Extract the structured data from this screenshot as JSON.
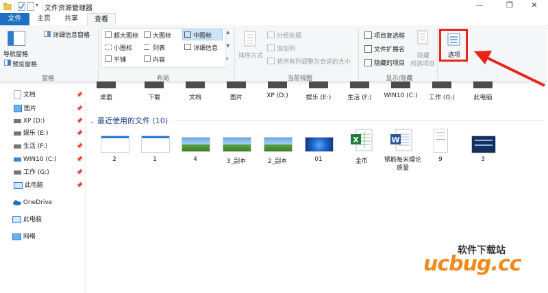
{
  "window": {
    "title": "文件资源管理器",
    "controls": {
      "minimize": "—",
      "maximize": "❐",
      "close": "✕"
    }
  },
  "tabs": [
    {
      "label": "文件"
    },
    {
      "label": "主页"
    },
    {
      "label": "共享"
    },
    {
      "label": "查看"
    }
  ],
  "ribbon": {
    "panes": {
      "group_label": "窗格",
      "nav_pane": "导航窗格",
      "preview_pane": "预览窗格",
      "details_pane": "详细信息窗格"
    },
    "layout": {
      "group_label": "布局",
      "items": [
        "超大图标",
        "大图标",
        "中图标",
        "小图标",
        "列表",
        "详细信息",
        "平铺",
        "内容"
      ]
    },
    "current_view": {
      "group_label": "当前视图",
      "sort": "排序方式",
      "group_by": "分组依据",
      "add_column": "添加列",
      "fit_columns": "将所有列调整为合适的大小"
    },
    "show_hide": {
      "group_label": "显示/隐藏",
      "item_checkboxes": "项目复选框",
      "file_extensions": "文件扩展名",
      "hidden_items": "隐藏的项目",
      "hide": "隐藏",
      "selected_items": "所选项目"
    },
    "options": {
      "label": "选项"
    }
  },
  "nav": {
    "quick": [
      {
        "label": "文档"
      },
      {
        "label": "图片"
      },
      {
        "label": "XP (D:)"
      },
      {
        "label": "娱乐 (E:)"
      },
      {
        "label": "生活 (F:)"
      },
      {
        "label": "WIN10 (C:)"
      },
      {
        "label": "工作 (G:)"
      },
      {
        "label": "此电脑"
      }
    ],
    "onedrive": "OneDrive",
    "thispc": "此电脑",
    "network": "网络"
  },
  "folders": [
    "桌面",
    "下载",
    "文档",
    "图片",
    "XP (D:)",
    "娱乐 (E:)",
    "生活 (F:)",
    "WIN10 (C:)",
    "工作 (G:)",
    "此电脑"
  ],
  "recent": {
    "header": "最近使用的文件 (10)",
    "files": [
      {
        "label": "2"
      },
      {
        "label": "1"
      },
      {
        "label": "4"
      },
      {
        "label": "3_副本"
      },
      {
        "label": "2_副本"
      },
      {
        "label": "01"
      },
      {
        "label": "金币"
      },
      {
        "label": "钢筋每米理论质量"
      },
      {
        "label": "9"
      },
      {
        "label": "3"
      }
    ]
  },
  "watermark": {
    "site_cn": "软件下载站",
    "site_en": "ucbug.cc"
  },
  "colors": {
    "accent": "#1e6fc2",
    "highlight_box": "#e8231a",
    "arrow": "#e8231a"
  }
}
